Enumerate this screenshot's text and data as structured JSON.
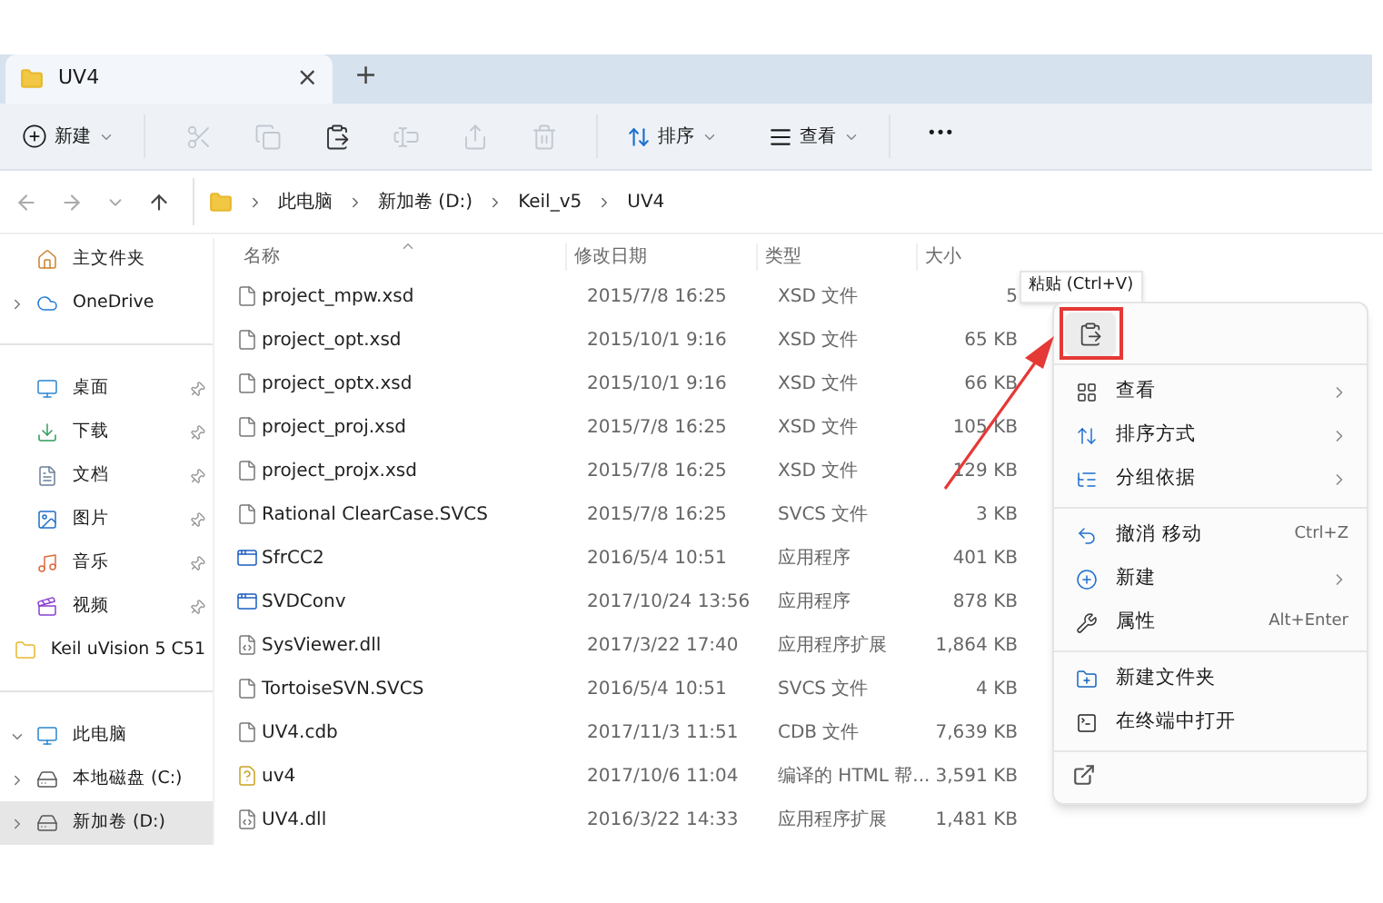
{
  "tab": {
    "title": "UV4",
    "close": "×",
    "new_tab": "+"
  },
  "toolbar": {
    "new_label": "新建",
    "sort_label": "排序",
    "view_label": "查看",
    "more": "•••",
    "icon_buttons": [
      {
        "kind": "cut",
        "disabled": true
      },
      {
        "kind": "copy",
        "disabled": true
      },
      {
        "kind": "paste",
        "disabled": false
      },
      {
        "kind": "rename",
        "disabled": true
      },
      {
        "kind": "share",
        "disabled": true
      },
      {
        "kind": "delete",
        "disabled": true
      }
    ]
  },
  "breadcrumb": [
    "此电脑",
    "新加卷 (D:)",
    "Keil_v5",
    "UV4"
  ],
  "sidebar": {
    "groups": [
      [
        {
          "label": "主文件夹",
          "kind": "home",
          "pinned": false,
          "selected": false
        },
        {
          "label": "OneDrive",
          "kind": "cloud",
          "pinned": false,
          "expanded": false,
          "selected": false
        }
      ],
      [
        {
          "label": "桌面",
          "kind": "desktop",
          "pinned": true,
          "selected": false
        },
        {
          "label": "下载",
          "kind": "download",
          "pinned": true,
          "selected": false
        },
        {
          "label": "文档",
          "kind": "document",
          "pinned": true,
          "selected": false
        },
        {
          "label": "图片",
          "kind": "picture",
          "pinned": true,
          "selected": false
        },
        {
          "label": "音乐",
          "kind": "music",
          "pinned": true,
          "selected": false
        },
        {
          "label": "视频",
          "kind": "video",
          "pinned": true,
          "selected": false
        },
        {
          "label": "Keil uVision 5 C51",
          "kind": "folder",
          "pinned": false,
          "selected": false
        }
      ],
      [
        {
          "label": "此电脑",
          "kind": "pc",
          "pinned": false,
          "expanded": true,
          "selected": false
        },
        {
          "label": "本地磁盘 (C:)",
          "kind": "drive",
          "pinned": false,
          "expanded": false,
          "selected": false
        },
        {
          "label": "新加卷 (D:)",
          "kind": "drive",
          "pinned": false,
          "expanded": false,
          "selected": true
        }
      ]
    ]
  },
  "table": {
    "columns": [
      "名称",
      "修改日期",
      "类型",
      "大小"
    ],
    "rows": [
      {
        "kind": "file",
        "name": "project_mpw.xsd",
        "date": "2015/7/8 16:25",
        "type": "XSD 文件",
        "size": "5"
      },
      {
        "kind": "file",
        "name": "project_opt.xsd",
        "date": "2015/10/1 9:16",
        "type": "XSD 文件",
        "size": "65 KB"
      },
      {
        "kind": "file",
        "name": "project_optx.xsd",
        "date": "2015/10/1 9:16",
        "type": "XSD 文件",
        "size": "66 KB"
      },
      {
        "kind": "file",
        "name": "project_proj.xsd",
        "date": "2015/7/8 16:25",
        "type": "XSD 文件",
        "size": "105 KB"
      },
      {
        "kind": "file",
        "name": "project_projx.xsd",
        "date": "2015/7/8 16:25",
        "type": "XSD 文件",
        "size": "129 KB"
      },
      {
        "kind": "file",
        "name": "Rational ClearCase.SVCS",
        "date": "2015/7/8 16:25",
        "type": "SVCS 文件",
        "size": "3 KB"
      },
      {
        "kind": "app",
        "name": "SfrCC2",
        "date": "2016/5/4 10:51",
        "type": "应用程序",
        "size": "401 KB"
      },
      {
        "kind": "app",
        "name": "SVDConv",
        "date": "2017/10/24 13:56",
        "type": "应用程序",
        "size": "878 KB"
      },
      {
        "kind": "dll",
        "name": "SysViewer.dll",
        "date": "2017/3/22 17:40",
        "type": "应用程序扩展",
        "size": "1,864 KB"
      },
      {
        "kind": "file",
        "name": "TortoiseSVN.SVCS",
        "date": "2016/5/4 10:51",
        "type": "SVCS 文件",
        "size": "4 KB"
      },
      {
        "kind": "file",
        "name": "UV4.cdb",
        "date": "2017/11/3 11:51",
        "type": "CDB 文件",
        "size": "7,639 KB"
      },
      {
        "kind": "help",
        "name": "uv4",
        "date": "2017/10/6 11:04",
        "type": "编译的 HTML 帮...",
        "size": "3,591 KB"
      },
      {
        "kind": "dll",
        "name": "UV4.dll",
        "date": "2016/3/22 14:33",
        "type": "应用程序扩展",
        "size": "1,481 KB"
      }
    ]
  },
  "tooltip": "粘贴 (Ctrl+V)",
  "context_menu": {
    "groups": [
      [
        {
          "kind": "view",
          "label": "查看",
          "submenu": true
        },
        {
          "kind": "sort",
          "label": "排序方式",
          "submenu": true
        },
        {
          "kind": "group",
          "label": "分组依据",
          "submenu": true
        }
      ],
      [
        {
          "kind": "undo",
          "label": "撤消 移动",
          "shortcut": "Ctrl+Z",
          "submenu": false
        },
        {
          "kind": "new",
          "label": "新建",
          "submenu": true
        },
        {
          "kind": "properties",
          "label": "属性",
          "shortcut": "Alt+Enter",
          "submenu": false
        }
      ],
      [
        {
          "kind": "newfolder",
          "label": "新建文件夹",
          "submenu": false
        },
        {
          "kind": "terminal",
          "label": "在终端中打开",
          "submenu": false
        }
      ]
    ]
  }
}
